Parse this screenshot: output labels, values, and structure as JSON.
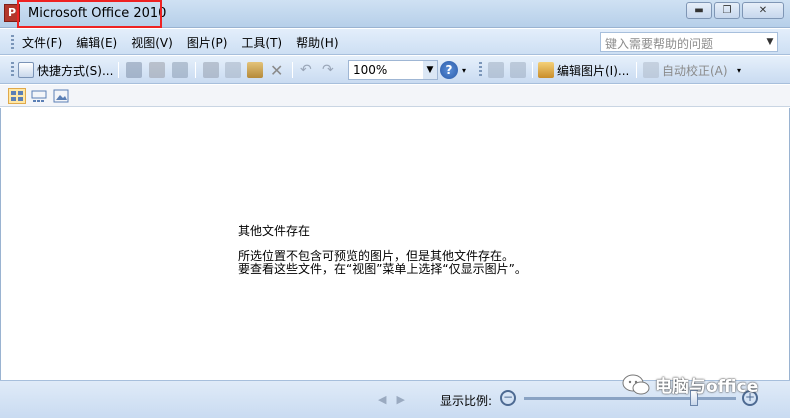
{
  "window": {
    "app_icon": "picture-manager-icon",
    "title": "Microsoft Office 2010",
    "controls": [
      "minimize",
      "maximize",
      "close"
    ]
  },
  "menubar": {
    "items": [
      {
        "label": "文件(F)"
      },
      {
        "label": "编辑(E)"
      },
      {
        "label": "视图(V)"
      },
      {
        "label": "图片(P)"
      },
      {
        "label": "工具(T)"
      },
      {
        "label": "帮助(H)"
      }
    ],
    "help_placeholder": "键入需要帮助的问题"
  },
  "toolbar": {
    "shortcuts_label": "快捷方式(S)...",
    "zoom_value": "100%",
    "edit_picture_label": "编辑图片(I)...",
    "auto_correct_label": "自动校正(A)"
  },
  "content": {
    "title": "其他文件存在",
    "line1": "所选位置不包含可预览的图片，但是其他文件存在。",
    "line2": "要查看这些文件，在“视图”菜单上选择“仅显示图片”。"
  },
  "statusbar": {
    "zoom_label": "显示比例:",
    "zoom_level": 0.8
  },
  "watermark": {
    "text": "电脑与office"
  }
}
